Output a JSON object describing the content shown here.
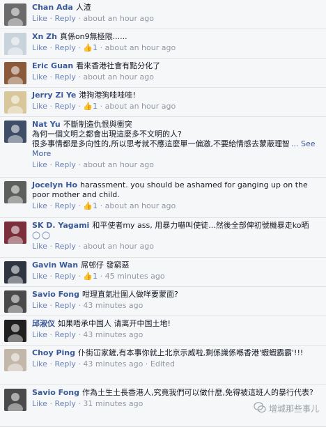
{
  "labels": {
    "like": "Like",
    "reply": "Reply",
    "separator": "·",
    "see_more": "... See More",
    "thumb": "👍"
  },
  "comments": [
    {
      "name": "Chan Ada",
      "text": "人渣",
      "likes": "",
      "time": "about an hour ago",
      "avatar_color": "#6b6b6b"
    },
    {
      "name": "Xn Zh",
      "text": "真係on9無極限......",
      "likes": "1",
      "time": "about an hour ago",
      "avatar_color": "#c9d3dc"
    },
    {
      "name": "Eric Guan",
      "text": "看來香港社會有點分化了",
      "likes": "",
      "time": "about an hour ago",
      "avatar_color": "#8a5a3a"
    },
    {
      "name": "Jerry Zi Ye",
      "text": "港狗港狗哇哇哇!",
      "likes": "1",
      "time": "about an hour ago",
      "avatar_color": "#d8c79a"
    },
    {
      "name": "Nat Yu",
      "text": "不斷制造仇恨與衝突\n為何一個文明之都會出現這麼多不文明的人?\n很多事情都是多向性的,所以思考就不應這麼單一偏激,不要給情感去蒙蔽理智",
      "see_more": true,
      "likes": "",
      "time": "about an hour ago",
      "avatar_color": "#3f4d66"
    },
    {
      "name": "Jocelyn Ho",
      "text": "harassment. you should be ashamed for ganging up on the poor mother and child.",
      "likes": "1",
      "time": "about an hour ago",
      "avatar_color": "#5c5f5c"
    },
    {
      "name": "SK D. Yagami",
      "text": "和平使者my ass, 用暴力嚇叫使徒...然後全部俾初號機暴走ko晒",
      "emoji": true,
      "likes": "",
      "time": "about an hour ago",
      "avatar_color": "#7a2f3a"
    },
    {
      "name": "Gavin Wan",
      "text": "屌邨仔 發窮惡",
      "likes": "1",
      "time": "45 minutes ago",
      "avatar_color": "#2f3540"
    },
    {
      "name": "Savio Fong",
      "text": "咁理直氣壯圍人做咩要蒙面?",
      "likes": "",
      "time": "43 minutes ago",
      "avatar_color": "#4a4a4a"
    },
    {
      "name": "邱淑仪",
      "text": "如果唔承中国人 请离开中国土地!",
      "likes": "",
      "time": "43 minutes ago",
      "avatar_color": "#1f1f1f"
    },
    {
      "name": "Choy Ping",
      "text": "仆街冚家鏟,有本事你就上北京示威啦,剩係識係喺香港'蝦蝦霸霸'!!!",
      "likes": "",
      "time": "43 minutes ago",
      "edited": "Edited",
      "avatar_color": "#c2b7a8"
    },
    {
      "name": "Savio Fong",
      "text": "作為土生土長香港人,究竟我們可以做什麼,免得被這班人的暴行代表?",
      "likes": "",
      "time": "31 minutes ago",
      "avatar_color": "#4a4a4a"
    }
  ],
  "watermark": {
    "text": "增城那些事儿"
  }
}
